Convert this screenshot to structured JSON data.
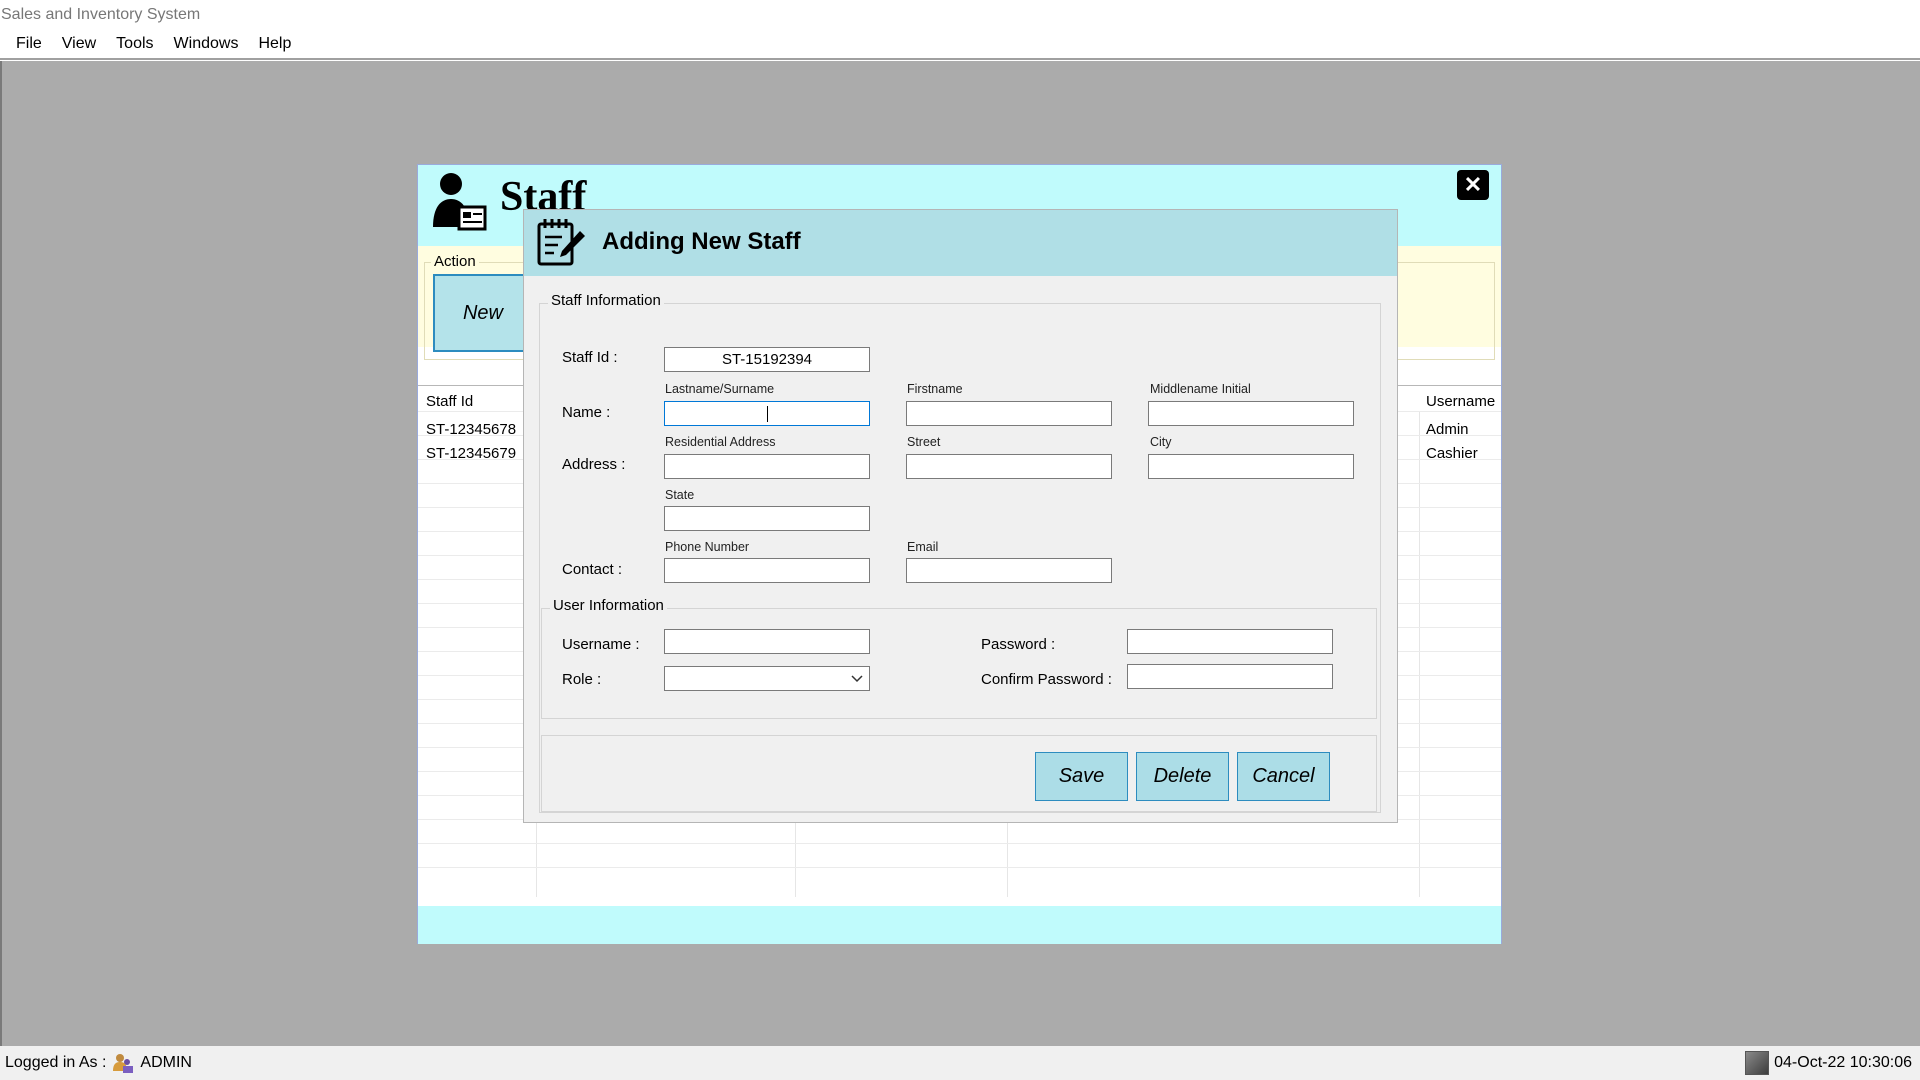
{
  "app": {
    "title": "Sales and Inventory System"
  },
  "menu": {
    "items": [
      "File",
      "View",
      "Tools",
      "Windows",
      "Help"
    ]
  },
  "status": {
    "logged_in_label": "Logged in As :",
    "user": "ADMIN",
    "datetime": "04-Oct-22 10:30:06"
  },
  "staff_window": {
    "title": "Staff",
    "action_group": "Action",
    "new_button": "New",
    "grid": {
      "columns": [
        "Staff Id",
        "Username"
      ],
      "rows": [
        {
          "staff_id": "ST-12345678",
          "username": "Admin"
        },
        {
          "staff_id": "ST-12345679",
          "username": "Cashier"
        }
      ]
    }
  },
  "dialog": {
    "title": "Adding New Staff",
    "staff_info": {
      "legend": "Staff Information",
      "staff_id_label": "Staff Id :",
      "staff_id_value": "ST-15192394",
      "name_label": "Name :",
      "lastname_caption": "Lastname/Surname",
      "firstname_caption": "Firstname",
      "middlename_caption": "Middlename Initial",
      "address_label": "Address :",
      "residential_caption": "Residential Address",
      "street_caption": "Street",
      "city_caption": "City",
      "state_caption": "State",
      "contact_label": "Contact  :",
      "phone_caption": "Phone Number",
      "email_caption": "Email"
    },
    "user_info": {
      "legend": "User Information",
      "username_label": "Username :",
      "password_label": "Password :",
      "role_label": "Role :",
      "confirm_label": "Confirm Password :",
      "role_value": ""
    },
    "buttons": {
      "save": "Save",
      "delete": "Delete",
      "cancel": "Cancel"
    }
  },
  "colors": {
    "staff_header": "#c0fbfc",
    "action_strip": "#fffde0",
    "dialog_header": "#b0dfe6",
    "button_fill": "#acdde7",
    "button_border": "#2d8cbf",
    "mdi_background": "#ababab"
  },
  "icons": [
    "staff-user-card-icon",
    "notepad-pencil-icon",
    "close-icon",
    "user-status-icon",
    "clock-status-icon",
    "chevron-down-icon",
    "scroll-left-icon",
    "scroll-right-icon"
  ]
}
